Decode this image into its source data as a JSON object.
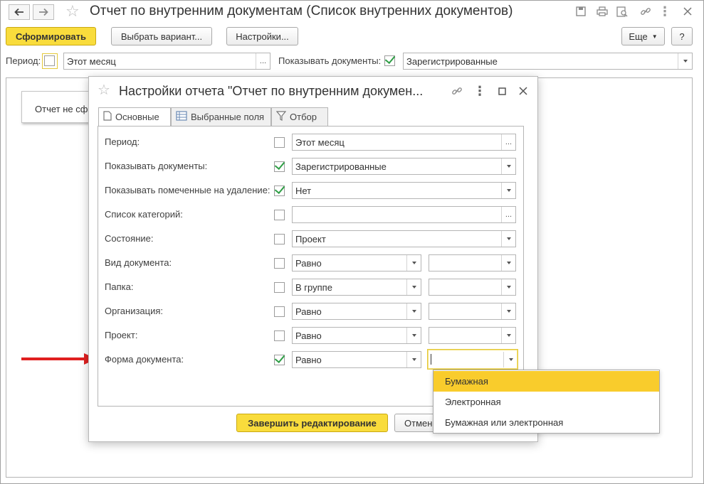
{
  "window": {
    "title": "Отчет по внутренним документам (Список внутренних документов)"
  },
  "toolbar": {
    "generate_label": "Сформировать",
    "choose_variant_label": "Выбрать вариант...",
    "settings_label": "Настройки...",
    "more_label": "Еще",
    "help_label": "?"
  },
  "params": {
    "period_label": "Период:",
    "period_value": "Этот месяц",
    "show_docs_label": "Показывать документы:",
    "show_docs_value": "Зарегистрированные"
  },
  "report_area": {
    "message": "Отчет не сформирован"
  },
  "dialog": {
    "title": "Настройки отчета \"Отчет по внутренним докумен...",
    "tabs": [
      {
        "label": "Основные",
        "icon": "document-icon",
        "active": true
      },
      {
        "label": "Выбранные поля",
        "icon": "fields-icon",
        "active": false
      },
      {
        "label": "Отбор",
        "icon": "filter-icon",
        "active": false
      }
    ],
    "rows": [
      {
        "label": "Период:",
        "checked": false,
        "value": "Этот месяц"
      },
      {
        "label": "Показывать документы:",
        "checked": true,
        "value": "Зарегистрированные"
      },
      {
        "label": "Показывать помеченные на удаление:",
        "checked": true,
        "value": "Нет"
      },
      {
        "label": "Список категорий:",
        "checked": false,
        "value": ""
      },
      {
        "label": "Состояние:",
        "checked": false,
        "value": "Проект"
      },
      {
        "label": "Вид документа:",
        "checked": false,
        "value": "Равно",
        "value2": ""
      },
      {
        "label": "Папка:",
        "checked": false,
        "value": "В группе",
        "value2": ""
      },
      {
        "label": "Организация:",
        "checked": false,
        "value": "Равно",
        "value2": ""
      },
      {
        "label": "Проект:",
        "checked": false,
        "value": "Равно",
        "value2": ""
      },
      {
        "label": "Форма документа:",
        "checked": true,
        "value": "Равно",
        "value2": ""
      }
    ],
    "finish_label": "Завершить редактирование",
    "cancel_label": "Отмена"
  },
  "dropdown": {
    "options": [
      "Бумажная",
      "Электронная",
      "Бумажная или электронная"
    ],
    "selected": "Бумажная"
  },
  "colors": {
    "accent_yellow": "#f9dc3c",
    "selected_option": "#f9cc2c",
    "check_green": "#2f9e46",
    "arrow_red": "#e02020"
  }
}
